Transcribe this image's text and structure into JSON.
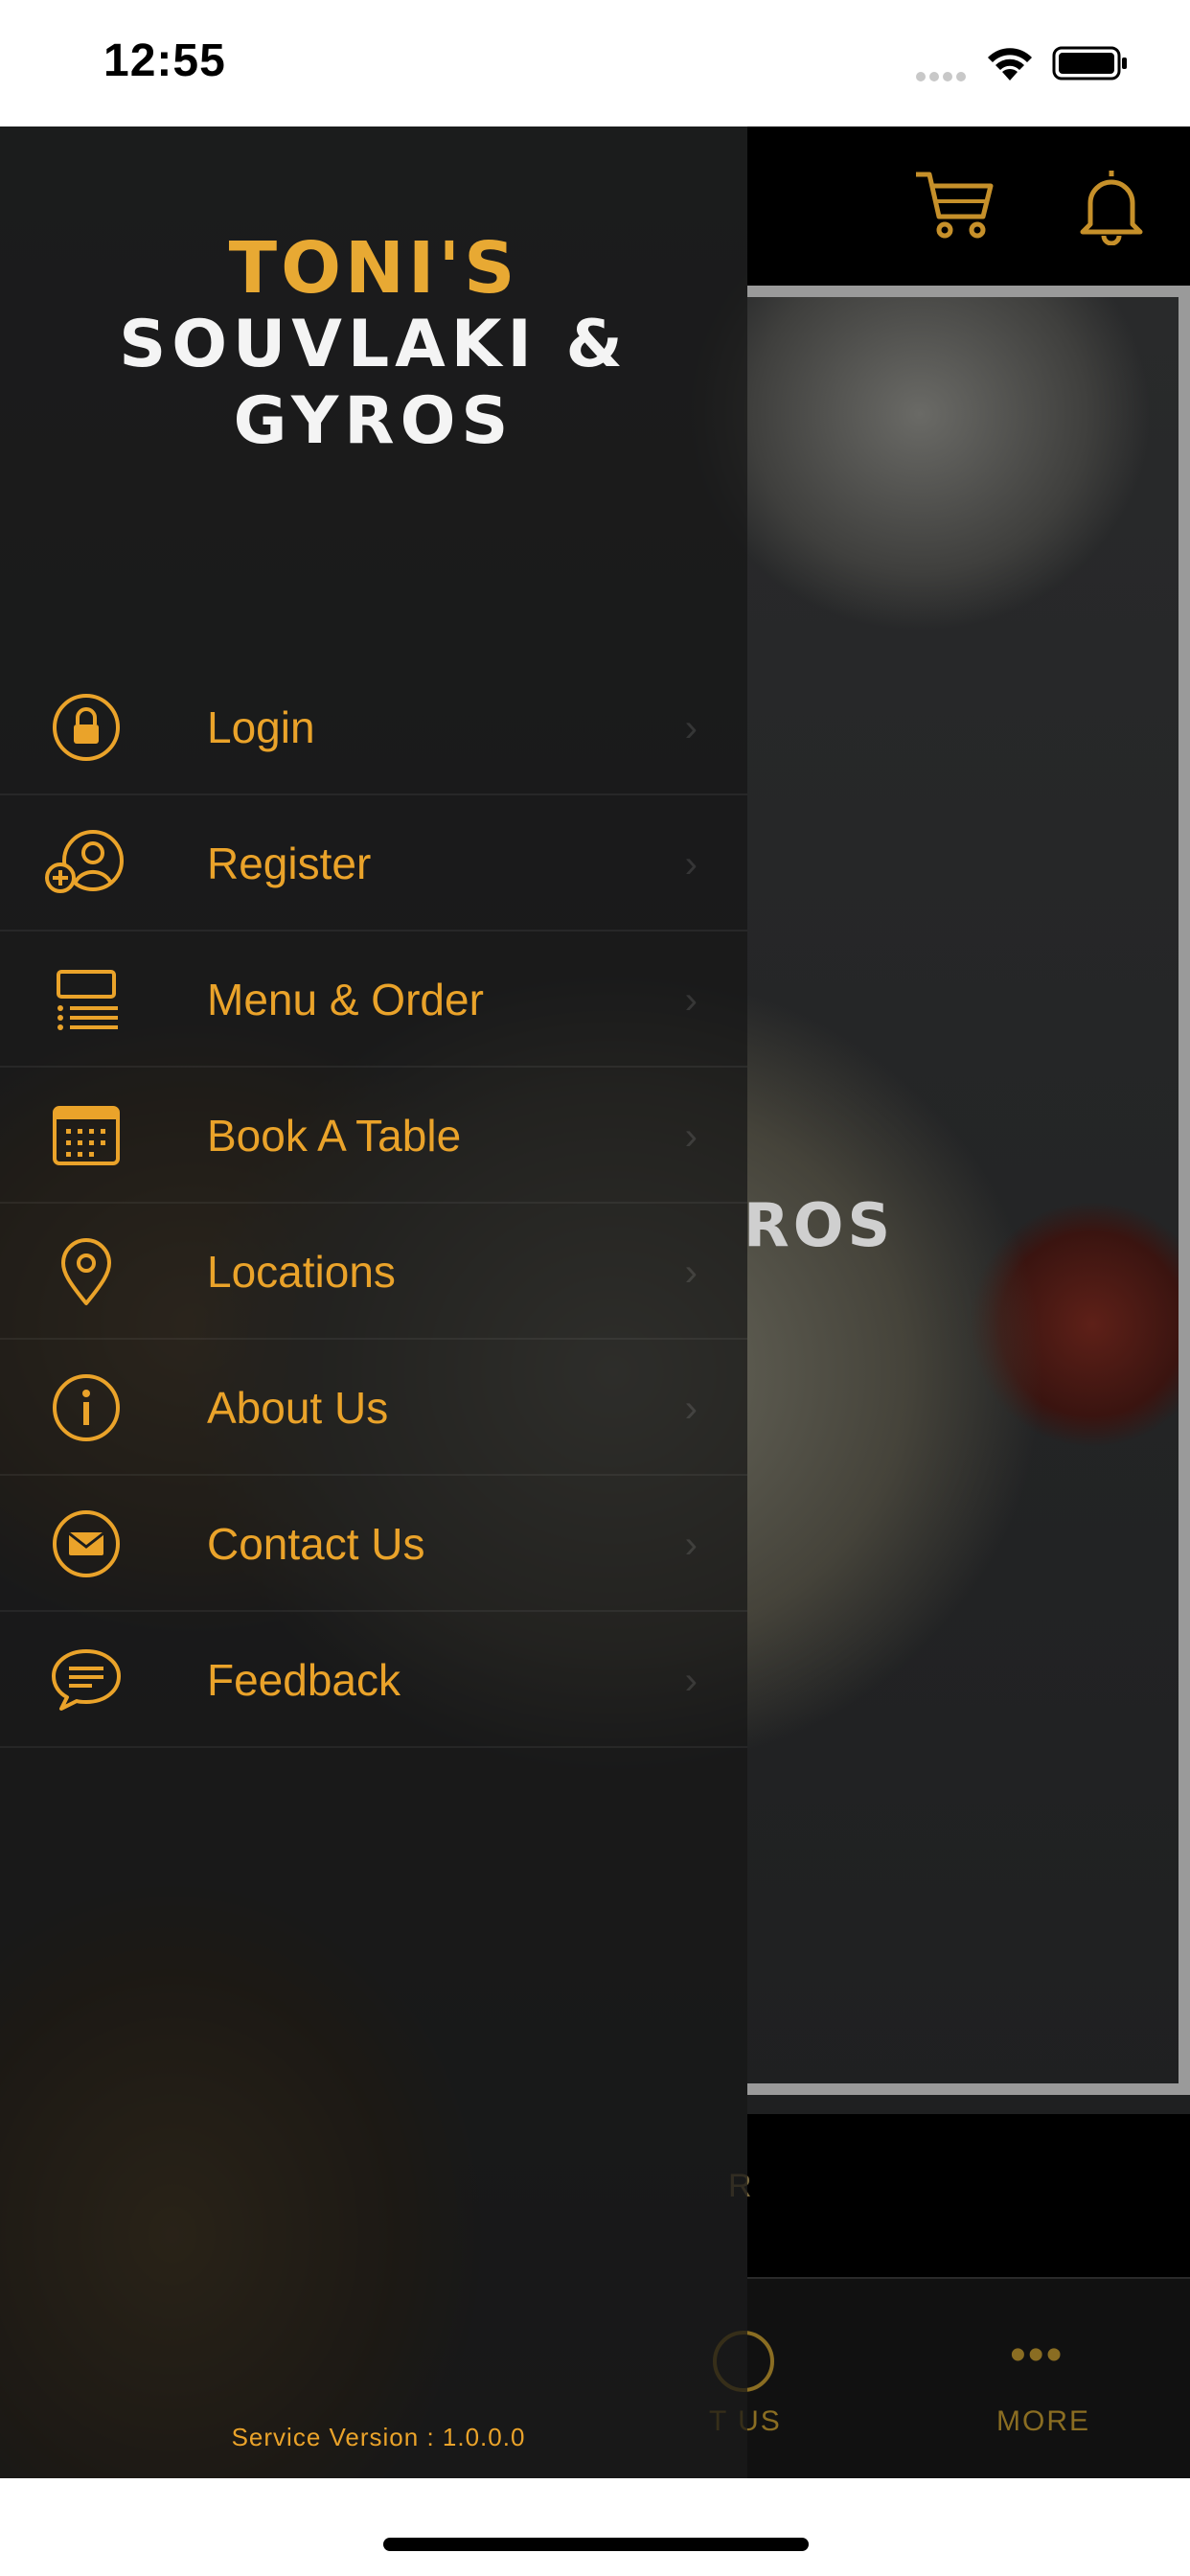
{
  "status_bar": {
    "time": "12:55"
  },
  "brand": {
    "line1": "TONI'S",
    "line2": "SOUVLAKI & GYROS"
  },
  "menu": {
    "items": [
      {
        "label": "Login",
        "icon": "lock-icon"
      },
      {
        "label": "Register",
        "icon": "add-user-icon"
      },
      {
        "label": "Menu & Order",
        "icon": "menu-list-icon"
      },
      {
        "label": "Book A Table",
        "icon": "calendar-icon"
      },
      {
        "label": "Locations",
        "icon": "location-pin-icon"
      },
      {
        "label": "About Us",
        "icon": "info-icon"
      },
      {
        "label": "Contact Us",
        "icon": "mail-icon"
      },
      {
        "label": "Feedback",
        "icon": "chat-icon"
      }
    ]
  },
  "version_text": "Service Version : 1.0.0.0",
  "background": {
    "logo_fragment": "ROS",
    "order_fragment": "R",
    "tabs": [
      {
        "label": "T US",
        "icon": "info-icon"
      },
      {
        "label": "MORE",
        "icon": "more-dots-icon"
      }
    ]
  },
  "colors": {
    "accent": "#eaa32a",
    "drawer_bg": "#161616"
  }
}
